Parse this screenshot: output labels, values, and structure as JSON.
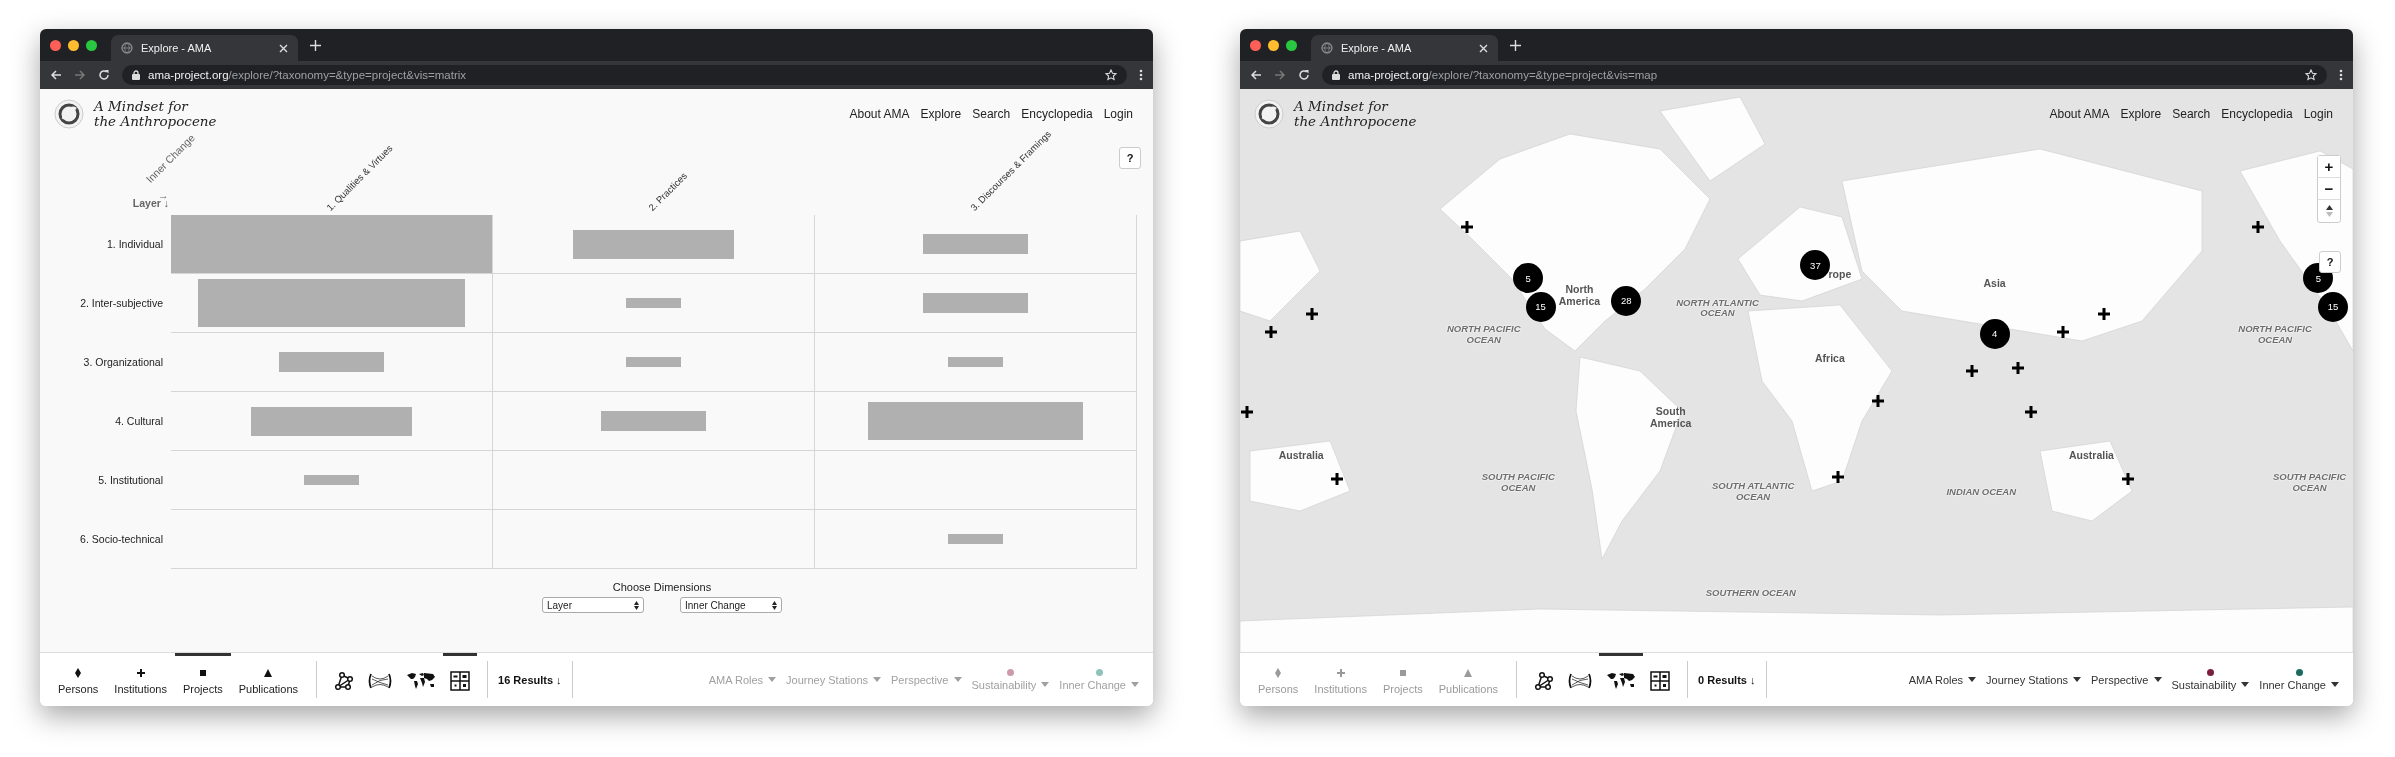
{
  "windows": [
    {
      "kind": "matrix",
      "tab": {
        "title": "Explore - AMA"
      },
      "url": {
        "host": "ama-project.org",
        "path": "/explore/?taxonomy=&type=project&vis=matrix"
      },
      "site": {
        "title_lines": [
          "A Mindset for",
          "the Anthropocene"
        ],
        "nav": [
          "About AMA",
          "Explore",
          "Search",
          "Encyclopedia",
          "Login"
        ]
      },
      "help": "?",
      "matrix": {
        "row_axis": "Layer ↓",
        "col_axis": "Inner Change",
        "col_arrow": "→",
        "columns": [
          "1. Qualities & Virtues",
          "2. Practices",
          "3. Discourses & Framings"
        ],
        "rows": [
          {
            "label": "1. Individual"
          },
          {
            "label": "2. Inter-subjective"
          },
          {
            "label": "3. Organizational"
          },
          {
            "label": "4. Cultural"
          },
          {
            "label": "5. Institutional"
          },
          {
            "label": "6. Socio-technical"
          }
        ],
        "dimensions_label": "Choose Dimensions",
        "selects": [
          {
            "value": "Layer"
          },
          {
            "value": "Inner Change"
          }
        ]
      },
      "bottom": {
        "types": [
          {
            "label": "Persons",
            "kind": "diamond",
            "selected": false,
            "disabled": false
          },
          {
            "label": "Institutions",
            "kind": "cross",
            "selected": false,
            "disabled": false
          },
          {
            "label": "Projects",
            "kind": "square",
            "selected": true,
            "disabled": false
          },
          {
            "label": "Publications",
            "kind": "triangle",
            "selected": false,
            "disabled": false
          }
        ],
        "views": [
          {
            "kind": "network",
            "selected": false
          },
          {
            "kind": "chord",
            "selected": false
          },
          {
            "kind": "map",
            "selected": false
          },
          {
            "kind": "matrix",
            "selected": true
          }
        ],
        "results": "16 Results ↓",
        "filters": [
          {
            "label": "AMA Roles",
            "disabled": true
          },
          {
            "label": "Journey Stations",
            "disabled": true
          },
          {
            "label": "Perspective",
            "disabled": true
          },
          {
            "label": "Sustainability",
            "disabled": true,
            "color": "#cc9aac"
          },
          {
            "label": "Inner Change",
            "disabled": true,
            "color": "#8ec3bb"
          }
        ]
      }
    },
    {
      "kind": "map",
      "tab": {
        "title": "Explore - AMA"
      },
      "url": {
        "host": "ama-project.org",
        "path": "/explore/?taxonomy=&type=project&vis=map"
      },
      "site": {
        "title_lines": [
          "A Mindset for",
          "the Anthropocene"
        ],
        "nav": [
          "About AMA",
          "Explore",
          "Search",
          "Encyclopedia",
          "Login"
        ]
      },
      "help": "?",
      "map": {
        "zoom_controls": [
          "+",
          "−"
        ],
        "labels": [
          {
            "kind": "continent",
            "lines": [
              "North",
              "America"
            ]
          },
          {
            "kind": "continent",
            "lines": [
              "rope"
            ]
          },
          {
            "kind": "continent",
            "lines": [
              "Asia"
            ]
          },
          {
            "kind": "continent",
            "lines": [
              "Africa"
            ]
          },
          {
            "kind": "continent",
            "lines": [
              "South",
              "America"
            ]
          },
          {
            "kind": "continent",
            "lines": [
              "Australia"
            ]
          },
          {
            "kind": "continent",
            "lines": [
              "Australia"
            ]
          },
          {
            "kind": "ocean",
            "lines": [
              "NORTH ATLANTIC",
              "OCEAN"
            ]
          },
          {
            "kind": "ocean",
            "lines": [
              "NORTH PACIFIC",
              "OCEAN"
            ]
          },
          {
            "kind": "ocean",
            "lines": [
              "NORTH PACIFIC",
              "OCEAN"
            ]
          },
          {
            "kind": "ocean",
            "lines": [
              "SOUTH PACIFIC",
              "OCEAN"
            ]
          },
          {
            "kind": "ocean",
            "lines": [
              "SOUTH PACIFIC",
              "OCEAN"
            ]
          },
          {
            "kind": "ocean",
            "lines": [
              "SOUTH ATLANTIC",
              "OCEAN"
            ]
          },
          {
            "kind": "ocean",
            "lines": [
              "INDIAN OCEAN"
            ]
          },
          {
            "kind": "ocean",
            "lines": [
              "SOUTHERN OCEAN"
            ]
          }
        ],
        "clusters": [
          {
            "count": "5"
          },
          {
            "count": "15"
          },
          {
            "count": "28"
          },
          {
            "count": "37"
          },
          {
            "count": "4"
          },
          {
            "count": "5"
          },
          {
            "count": "15"
          }
        ]
      },
      "bottom": {
        "types": [
          {
            "label": "Persons",
            "kind": "diamond",
            "selected": false,
            "disabled": true
          },
          {
            "label": "Institutions",
            "kind": "cross",
            "selected": false,
            "disabled": true
          },
          {
            "label": "Projects",
            "kind": "square",
            "selected": false,
            "disabled": true
          },
          {
            "label": "Publications",
            "kind": "triangle",
            "selected": false,
            "disabled": true
          }
        ],
        "views": [
          {
            "kind": "network",
            "selected": false
          },
          {
            "kind": "chord",
            "selected": false
          },
          {
            "kind": "map",
            "selected": true
          },
          {
            "kind": "matrix",
            "selected": false
          }
        ],
        "results": "0 Results ↓",
        "filters": [
          {
            "label": "AMA Roles",
            "disabled": false
          },
          {
            "label": "Journey Stations",
            "disabled": false
          },
          {
            "label": "Perspective",
            "disabled": false
          },
          {
            "label": "Sustainability",
            "disabled": false,
            "color": "#7a1f3d"
          },
          {
            "label": "Inner Change",
            "disabled": false,
            "color": "#1c6b63"
          }
        ]
      }
    }
  ]
}
